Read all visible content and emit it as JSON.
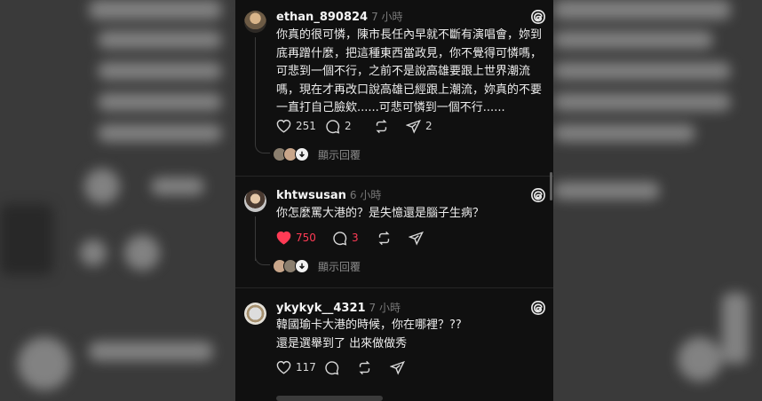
{
  "posts": [
    {
      "username": "ethan_890824",
      "time": "7 小時",
      "text": "你真的很可憐，陳市長任內早就不斷有演唱會，妳到底再蹭什麼，把這種東西當政見，你不覺得可憐嗎，可悲到一個不行，之前不是說高雄要跟上世界潮流嗎，現在才再改口說高雄已經跟上潮流，妳真的不要一直打自己臉欸......可悲可憐到一個不行......",
      "likes": "251",
      "replies": "2",
      "shares": "2",
      "show_replies": "顯示回覆",
      "liked": false
    },
    {
      "username": "khtwsusan",
      "time": "6 小時",
      "text": "你怎麼罵大港的？是失憶還是腦子生病？",
      "likes": "750",
      "replies": "3",
      "show_replies": "顯示回覆",
      "liked": true
    },
    {
      "username": "ykykyk__4321",
      "time": "7 小時",
      "text": "韓國瑜卡大港的時候，你在哪裡？??\n還是選舉到了 出來做做秀",
      "likes": "117",
      "liked": false
    }
  ],
  "colors": {
    "background": "#101010",
    "like_active": "#ff3b55",
    "text": "#ededed",
    "muted": "#7a7a7a"
  },
  "icons": [
    "heart-icon",
    "comment-icon",
    "repost-icon",
    "send-icon",
    "threads-logo-icon",
    "arrow-down-icon"
  ]
}
